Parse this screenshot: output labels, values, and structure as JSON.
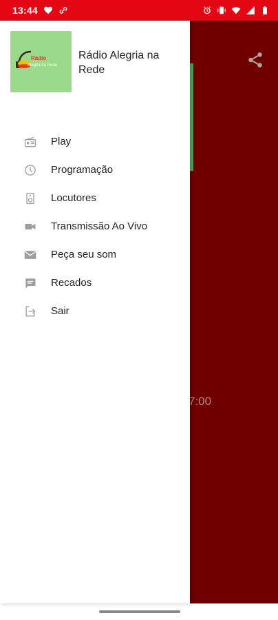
{
  "status_bar": {
    "time": "13:44",
    "left_icons": [
      "heart-notification-icon",
      "link-icon"
    ],
    "right_icons": [
      "alarm-icon",
      "vibrate-icon",
      "wifi-icon",
      "signal-icon",
      "battery-icon"
    ],
    "background_color": "#e30613"
  },
  "drawer": {
    "logo_text_line1": "Rádio",
    "logo_text_line2": "Alegria na Rede",
    "app_title": "Rádio Alegria na Rede",
    "menu": [
      {
        "label": "Play",
        "icon": "radio-icon"
      },
      {
        "label": "Programação",
        "icon": "clock-icon"
      },
      {
        "label": "Locutores",
        "icon": "speaker-icon"
      },
      {
        "label": "Transmissão Ao Vivo",
        "icon": "video-camera-icon"
      },
      {
        "label": "Peça seu som",
        "icon": "mail-icon"
      },
      {
        "label": "Recados",
        "icon": "chat-icon"
      },
      {
        "label": "Sair",
        "icon": "exit-icon"
      }
    ]
  },
  "background_screen": {
    "time_text": "7:00",
    "background_color": "#6e0000",
    "share_icon": "share-icon"
  }
}
